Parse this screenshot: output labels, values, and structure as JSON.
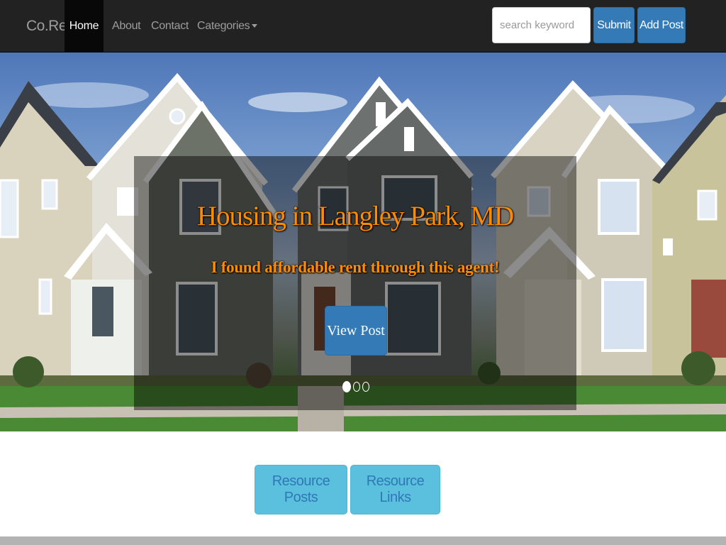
{
  "navbar": {
    "brand": "Co.Re",
    "links": [
      {
        "label": "Home",
        "active": true
      },
      {
        "label": "About"
      },
      {
        "label": "Contact"
      },
      {
        "label": "Categories"
      }
    ],
    "search_placeholder": "search keyword",
    "submit_label": "Submit",
    "add_post_label": "Add Post"
  },
  "carousel": {
    "title": "Housing in Langley Park, MD",
    "subtitle": "I found affordable rent through this agent!",
    "button_label": "View Post",
    "slide_count": 3,
    "active_slide": 1
  },
  "resources": {
    "posts_label": "Resource Posts",
    "links_label": "Resource Links"
  },
  "colors": {
    "navbar_bg": "#222222",
    "primary": "#337ab7",
    "info": "#5bc0de",
    "caption_text": "#ff8c00",
    "footer_bar": "#b3b3b3"
  }
}
